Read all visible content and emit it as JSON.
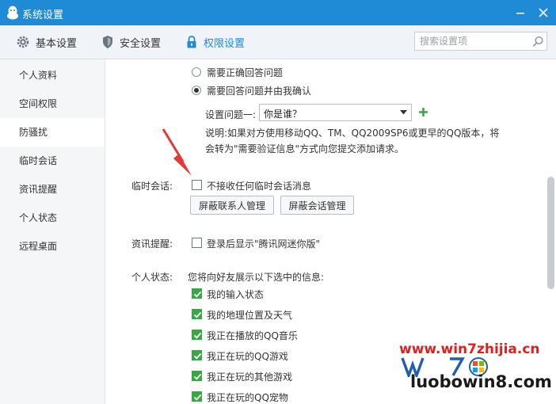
{
  "window": {
    "title": "系统设置"
  },
  "toolbar": {
    "tabs": [
      {
        "label": "基本设置",
        "icon": "gear-icon"
      },
      {
        "label": "安全设置",
        "icon": "shield-icon"
      },
      {
        "label": "权限设置",
        "icon": "lock-icon",
        "active": true
      }
    ],
    "search_placeholder": "搜索设置项"
  },
  "sidebar": {
    "items": [
      {
        "label": "个人资料"
      },
      {
        "label": "空间权限"
      },
      {
        "label": "防骚扰",
        "active": true
      },
      {
        "label": "临时会话"
      },
      {
        "label": "资讯提醒"
      },
      {
        "label": "个人状态"
      },
      {
        "label": "远程桌面"
      }
    ]
  },
  "verify": {
    "option_correct_answer": "需要正确回答问题",
    "option_answer_confirm": "需要回答问题并由我确认",
    "question_label": "设置问题一:",
    "question_value": "你是谁？",
    "note_line1": "说明:如果对方使用移动QQ、TM、QQ2009SP6或更早的QQ版本，将",
    "note_line2": "会转为\"需要验证信息\"方式向您提交添加请求。"
  },
  "temp_session": {
    "label": "临时会话:",
    "checkbox_label": "不接收任何临时会话消息",
    "block_contacts_button": "屏蔽联系人管理",
    "block_session_button": "屏蔽会话管理"
  },
  "news_alert": {
    "label": "资讯提醒:",
    "checkbox_label": "登录后显示\"腾讯网迷你版\""
  },
  "status": {
    "label": "个人状态:",
    "desc": "您将向好友展示以下选中的信息:",
    "items": [
      {
        "label": "我的输入状态",
        "checked": true
      },
      {
        "label": "我的地理位置及天气",
        "checked": true
      },
      {
        "label": "我正在播放的QQ音乐",
        "checked": true
      },
      {
        "label": "我正在玩的QQ游戏",
        "checked": true
      },
      {
        "label": "我正在玩的其他游戏",
        "checked": true
      },
      {
        "label": "我正在玩的QQ宠物",
        "checked": true
      }
    ]
  },
  "watermark": {
    "line1": "www.win7zhijia.cn",
    "line2": "luobowin8.com"
  },
  "colors": {
    "accent": "#1f8ad6",
    "check": "#3ea546",
    "plus": "#3ea546",
    "arrow": "#e53935"
  }
}
